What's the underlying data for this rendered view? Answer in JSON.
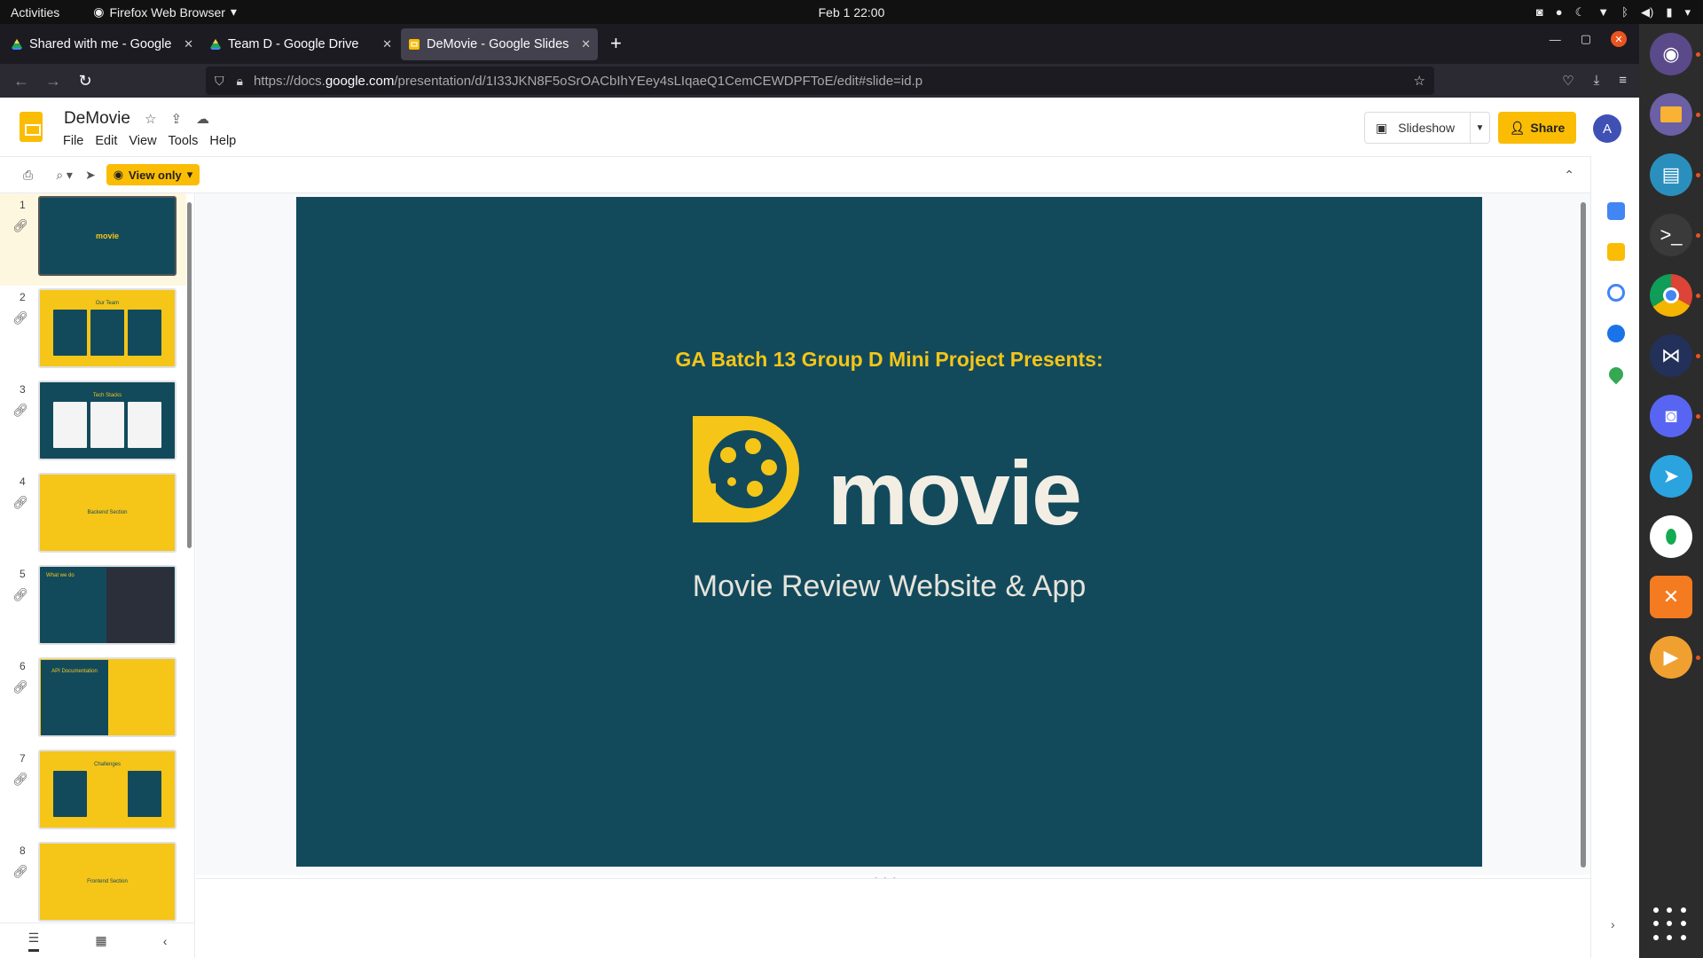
{
  "topbar": {
    "activities": "Activities",
    "app_name": "Firefox Web Browser",
    "clock": "Feb 1  22:00"
  },
  "browser": {
    "tabs": [
      {
        "title": "Shared with me - Google",
        "favicon": "google-drive-icon"
      },
      {
        "title": "Team D - Google Drive",
        "favicon": "google-drive-icon"
      },
      {
        "title": "DeMovie - Google Slides",
        "favicon": "google-slides-icon",
        "active": true
      }
    ],
    "url_prefix": "https://docs.",
    "url_domain": "google.com",
    "url_rest": "/presentation/d/1I33JKN8F5oSrOACbIhYEey4sLIqaeQ1CemCEWDPFToE/edit#slide=id.p"
  },
  "doc": {
    "title": "DeMovie",
    "menu": [
      "File",
      "Edit",
      "View",
      "Tools",
      "Help"
    ],
    "slideshow_label": "Slideshow",
    "share_label": "Share",
    "avatar_letter": "A",
    "view_only_label": "View only"
  },
  "filmstrip": {
    "slides": [
      {
        "num": "1",
        "style": "teal",
        "label": "movie",
        "selected": true
      },
      {
        "num": "2",
        "style": "yellow-team",
        "label": "Our Team"
      },
      {
        "num": "3",
        "style": "teal-stack",
        "label": "Tech Stacks"
      },
      {
        "num": "4",
        "style": "yellow",
        "label": "Backend Section"
      },
      {
        "num": "5",
        "style": "teal-photo",
        "label": "What we do"
      },
      {
        "num": "6",
        "style": "api",
        "label": "API Documentation"
      },
      {
        "num": "7",
        "style": "yellow-challenges",
        "label": "Challenges"
      },
      {
        "num": "8",
        "style": "yellow",
        "label": "Frontend Section"
      }
    ]
  },
  "slide": {
    "heading": "GA Batch 13 Group D Mini Project Presents:",
    "logo_word": "movie",
    "subtitle": "Movie Review Website & App"
  },
  "colors": {
    "slide_bg": "#124a5c",
    "accent_yellow": "#f5c518",
    "text_light": "#f2eee4"
  }
}
